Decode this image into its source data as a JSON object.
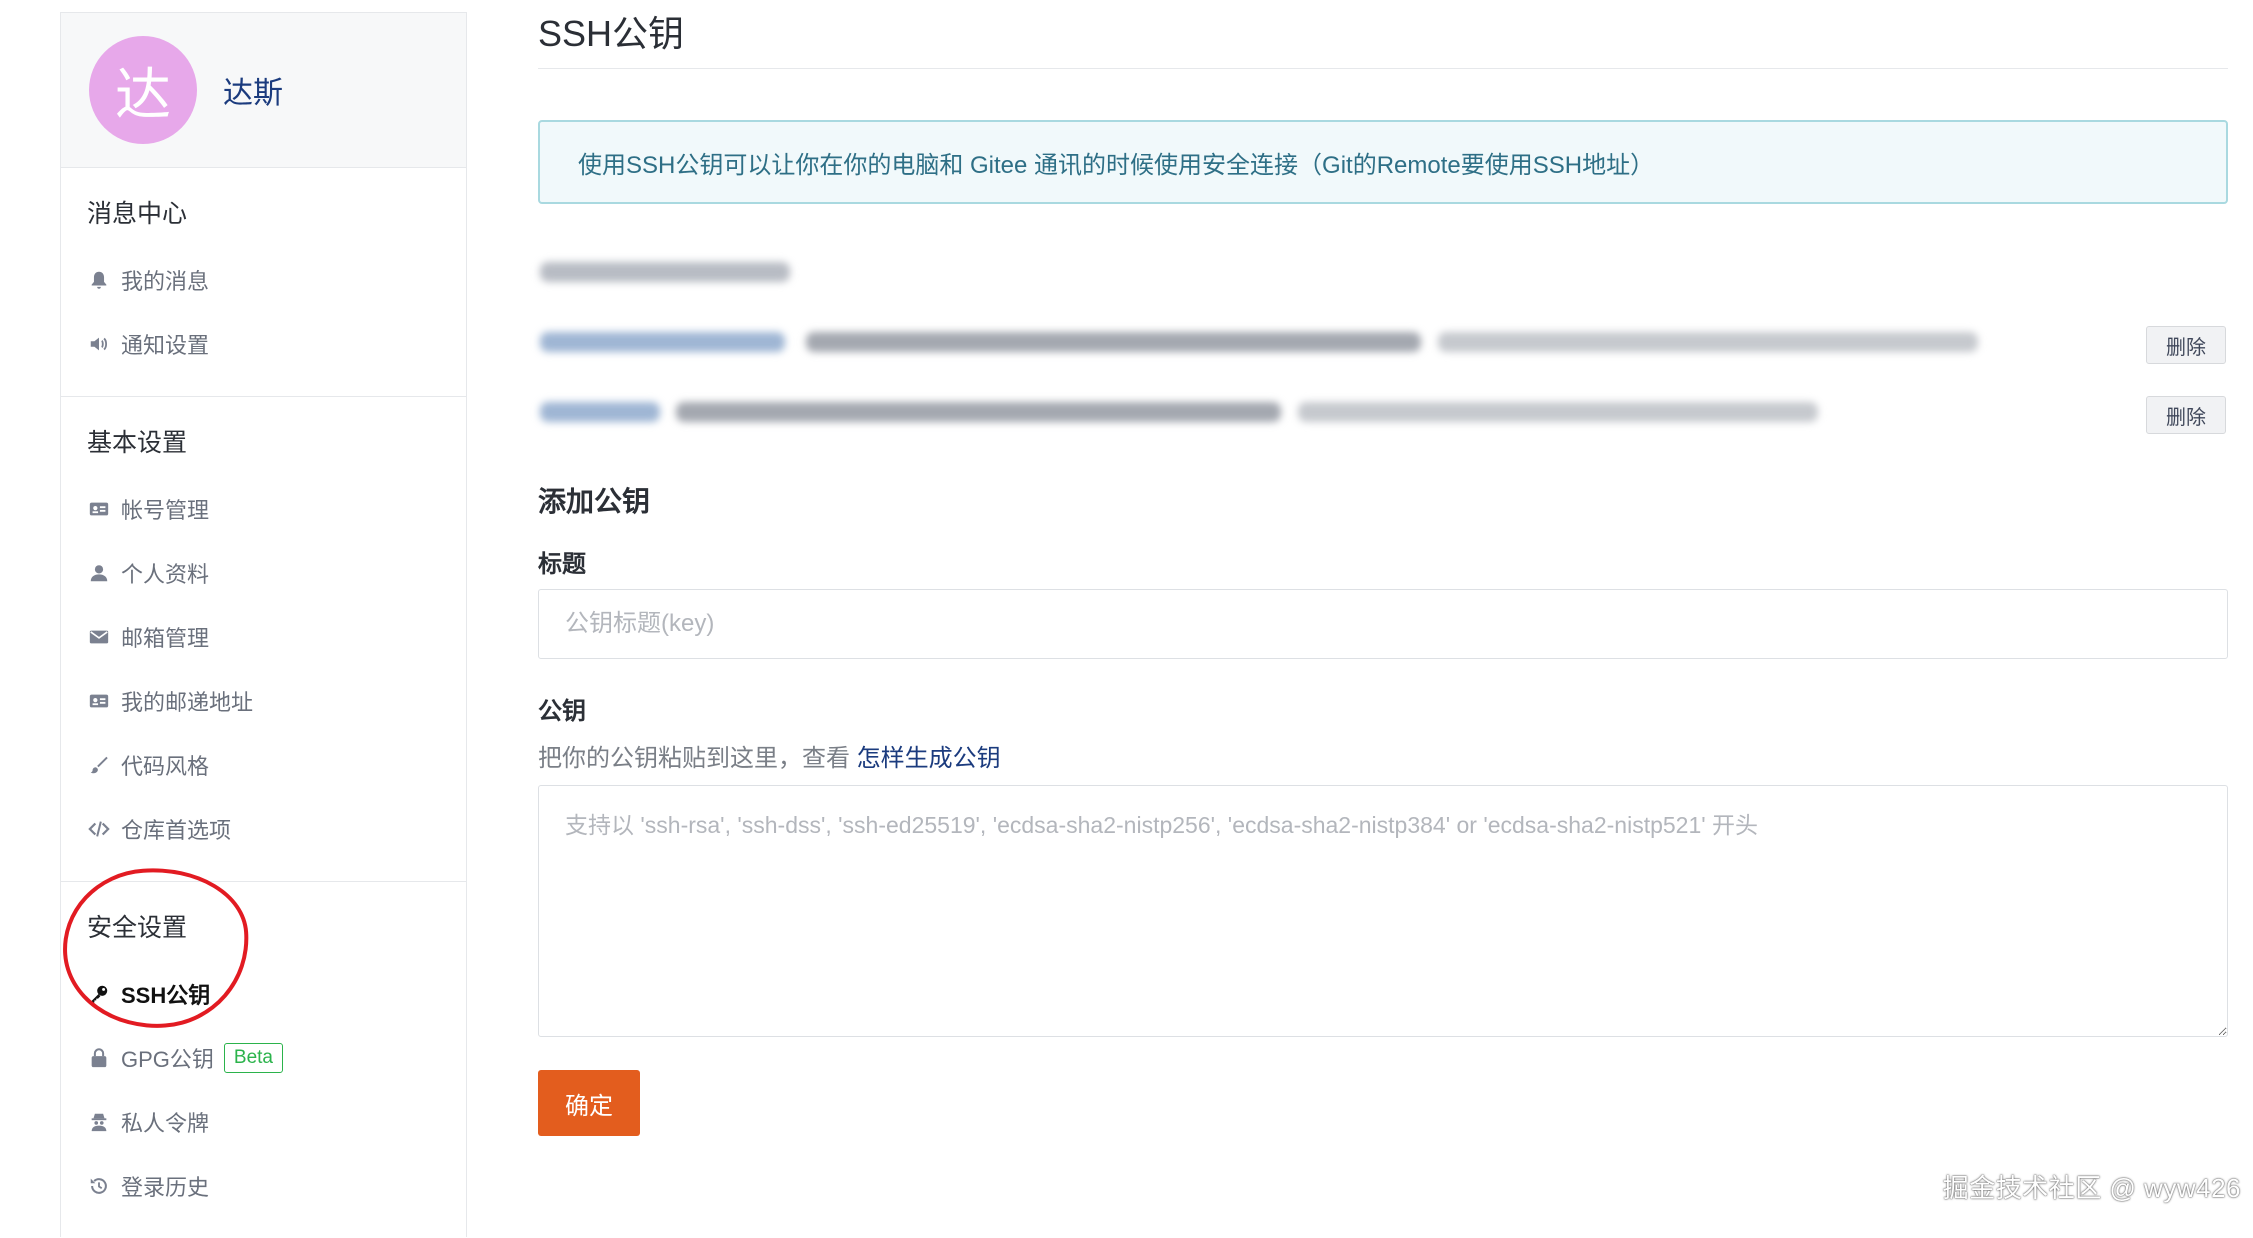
{
  "profile": {
    "avatar_char": "达",
    "username": "达斯",
    "avatar_color": "#e7a8ea"
  },
  "sidebar": {
    "sections": [
      {
        "title": "消息中心",
        "items": [
          {
            "icon": "bell-icon",
            "label": "我的消息"
          },
          {
            "icon": "speaker-icon",
            "label": "通知设置"
          }
        ]
      },
      {
        "title": "基本设置",
        "items": [
          {
            "icon": "id-card-icon",
            "label": "帐号管理"
          },
          {
            "icon": "user-icon",
            "label": "个人资料"
          },
          {
            "icon": "envelope-icon",
            "label": "邮箱管理"
          },
          {
            "icon": "address-card-icon",
            "label": "我的邮递地址"
          },
          {
            "icon": "brush-icon",
            "label": "代码风格"
          },
          {
            "icon": "code-icon",
            "label": "仓库首选项"
          }
        ]
      },
      {
        "title": "安全设置",
        "items": [
          {
            "icon": "key-icon",
            "label": "SSH公钥",
            "active": true
          },
          {
            "icon": "lock-icon",
            "label": "GPG公钥",
            "badge": "Beta"
          },
          {
            "icon": "user-secret-icon",
            "label": "私人令牌"
          },
          {
            "icon": "history-icon",
            "label": "登录历史"
          }
        ]
      }
    ]
  },
  "main": {
    "title": "SSH公钥",
    "info": "使用SSH公钥可以让你在你的电脑和 Gitee 通讯的时候使用安全连接（Git的Remote要使用SSH地址）",
    "delete_label": "删除",
    "add_title": "添加公钥",
    "title_label": "标题",
    "title_placeholder": "公钥标题(key)",
    "key_label": "公钥",
    "key_hint": "把你的公钥粘贴到这里，查看 ",
    "key_hint_link": "怎样生成公钥",
    "key_placeholder": "支持以 'ssh-rsa', 'ssh-dss', 'ssh-ed25519', 'ecdsa-sha2-nistp256', 'ecdsa-sha2-nistp384' or 'ecdsa-sha2-nistp521' 开头",
    "submit_label": "确定"
  },
  "watermark": "掘金技术社区 @ wyw426",
  "colors": {
    "accent": "#e35d1e",
    "link": "#1b3b7e",
    "beta": "#2bb34b",
    "annotation": "#e21b22"
  }
}
